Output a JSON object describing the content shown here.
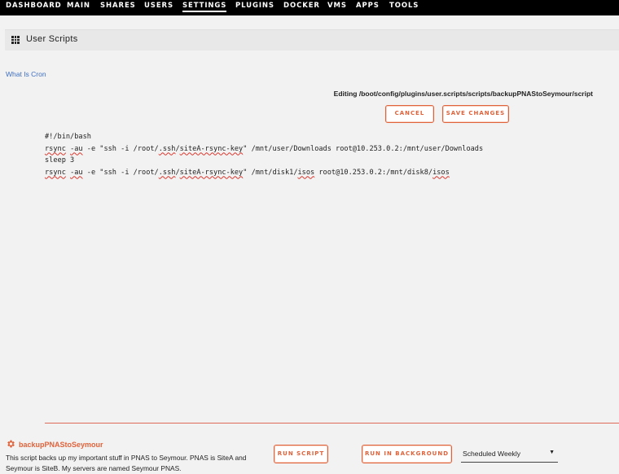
{
  "nav": {
    "items": [
      "DASHBOARD",
      "MAIN",
      "SHARES",
      "USERS",
      "SETTINGS",
      "PLUGINS",
      "DOCKER",
      "VMS",
      "APPS",
      "TOOLS"
    ],
    "active": "SETTINGS"
  },
  "header": {
    "title": "User Scripts",
    "icon": "grid-icon"
  },
  "cron_link": "What Is Cron",
  "editor": {
    "editing_label": "Editing /boot/config/plugins/user.scripts/scripts/backupPNAStoSeymour/script",
    "cancel_label": "CANCEL",
    "save_label": "SAVE CHANGES",
    "lines": [
      "#!/bin/bash",
      "rsync -au -e \"ssh -i /root/.ssh/siteA-rsync-key\" /mnt/user/Downloads root@10.253.0.2:/mnt/user/Downloads",
      "sleep 3",
      "rsync -au -e \"ssh -i /root/.ssh/siteA-rsync-key\" /mnt/disk1/isos root@10.253.0.2:/mnt/disk8/isos"
    ]
  },
  "script": {
    "name": "backupPNAStoSeymour",
    "icon": "gear-icon",
    "description": "This script backs up my important stuff in PNAS to Seymour. PNAS is SiteA and Seymour is SiteB. My servers are named Seymour PNAS.",
    "run_label": "RUN SCRIPT",
    "run_bg_label": "RUN IN BACKGROUND",
    "schedule": "Scheduled Weekly"
  },
  "colors": {
    "accent": "#e0623a",
    "link": "#3f6fbf",
    "nav_bg": "#000000",
    "page_bg": "#f2f2f2"
  }
}
